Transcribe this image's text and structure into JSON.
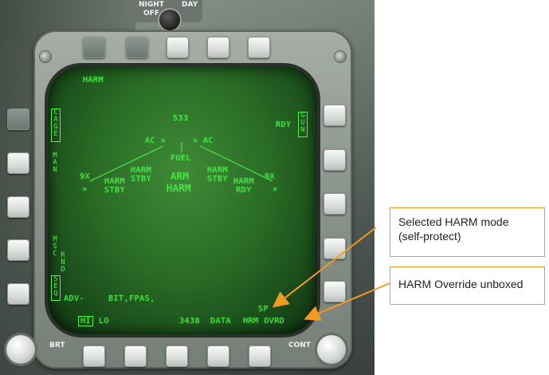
{
  "top_panel": {
    "night_label": "NIGHT",
    "day_label": "DAY",
    "off_label": "OFF"
  },
  "display": {
    "top_left_label": "HARM",
    "range_value": "533",
    "ready_label": "RDY",
    "left_box_1": [
      "C",
      "A",
      "G",
      "E"
    ],
    "left_vertical_1": [
      "M",
      "A",
      "N"
    ],
    "left_vertical_2": [
      "M",
      "S",
      "C"
    ],
    "left_vertical_3": [
      "R",
      "N",
      "D"
    ],
    "left_box_2": [
      "S",
      "E",
      "Q"
    ],
    "right_box": [
      "G",
      "U",
      "N"
    ],
    "ac_left": "AC ¤",
    "ac_right": "¤ AC",
    "fuel_label": "FUEL",
    "station_9x_left": "9X",
    "station_9x_right": "9X",
    "harm_stby_left_upper": [
      "HARM",
      "STBY"
    ],
    "harm_stby_left_lower": [
      "HARM",
      "STBY"
    ],
    "harm_stby_right_upper": [
      "HARM",
      "STBY"
    ],
    "harm_rdy_right_lower": [
      "HARM",
      "RDY"
    ],
    "arm_label": "ARM",
    "harm_center": "HARM",
    "adv_label": "ADV-",
    "bit_label": "BIT,FPAS,",
    "sp_label": "SP",
    "hi_label": "HI",
    "lo_label": "LO",
    "bottom_value": "3438",
    "data_label": "DATA",
    "hrm_ovrd_label": "HRM OVRD"
  },
  "knobs": {
    "brt_label": "BRT",
    "cont_label": "CONT"
  },
  "annotations": [
    {
      "text": "Selected HARM mode (self-protect)"
    },
    {
      "text": "HARM Override unboxed"
    }
  ],
  "colors": {
    "display_green": "#4ef24a",
    "annotation_orange": "#f39a21"
  }
}
